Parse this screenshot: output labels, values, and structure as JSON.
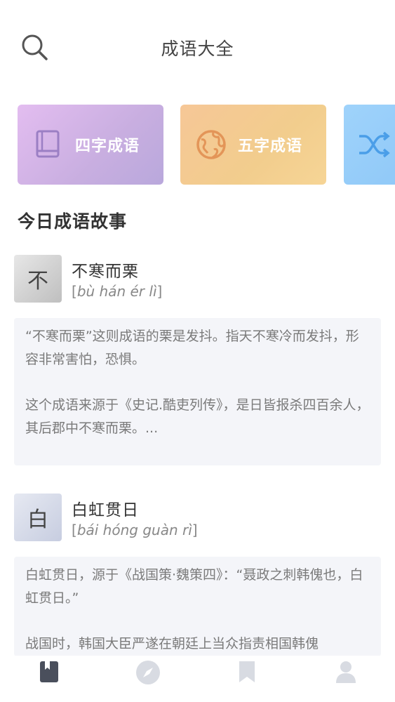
{
  "header": {
    "title": "成语大全",
    "search_icon": "search-icon"
  },
  "categories": [
    {
      "label": "四字成语",
      "icon": "book-icon",
      "color": "#c8aee0"
    },
    {
      "label": "五字成语",
      "icon": "globe-icon",
      "color": "#f2cd8d"
    },
    {
      "label": "",
      "icon": "shuffle-icon",
      "color": "#8ec7f7"
    }
  ],
  "section": {
    "title": "今日成语故事"
  },
  "stories": [
    {
      "char": "不",
      "name": "不寒而栗",
      "pinyin": "bù hán ér lì",
      "paragraphs": [
        "“不寒而栗”这则成语的栗是发抖。指天不寒冷而发抖，形容非常害怕，恐惧。",
        "这个成语来源于《史记.酷吏列传》，是日皆报杀四百余人，其后郡中不寒而栗。..."
      ]
    },
    {
      "char": "白",
      "name": "白虹贯日",
      "pinyin": "bái hóng guàn rì",
      "paragraphs": [
        "白虹贯日，源于《战国策·魏策四》：“聂政之刺韩傀也，白虹贯日。”",
        "战国时，韩国大臣严遂在朝廷上当众指责相国韩傀"
      ]
    }
  ],
  "tabbar": {
    "tabs": [
      {
        "icon": "book-tab-icon",
        "active": true
      },
      {
        "icon": "compass-tab-icon",
        "active": false
      },
      {
        "icon": "bookmark-tab-icon",
        "active": false
      },
      {
        "icon": "user-tab-icon",
        "active": false
      }
    ],
    "active_color": "#4a4f5c",
    "inactive_color": "#d8dbe2"
  }
}
